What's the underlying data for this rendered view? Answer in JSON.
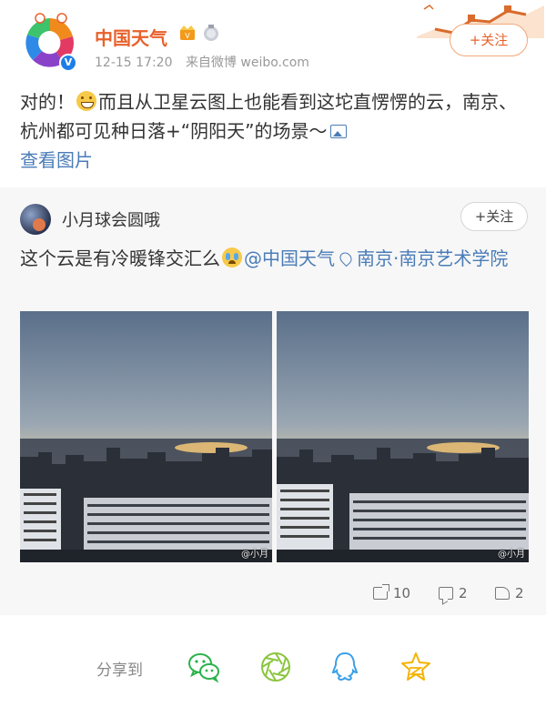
{
  "post": {
    "author": "中国天气",
    "time": "12-15 17:20",
    "source": "来自微博 weibo.com",
    "follow_label": "+关注",
    "text_part1": "对的！",
    "text_part2": "而且从卫星云图上也能看到这坨直愣愣的云，南京、杭州都可见种日落+“阴阳天”的场景～",
    "view_images_label": "查看图片"
  },
  "repost": {
    "author": "小月球会圆哦",
    "follow_label": "+关注",
    "text": "这个云是有冷暖锋交汇么",
    "mention": "@中国天气",
    "location": "南京·南京艺术学院",
    "watermark": "@小月",
    "stats": {
      "shares": "10",
      "comments": "2",
      "likes": "2"
    }
  },
  "share": {
    "label": "分享到",
    "targets": [
      "wechat-icon",
      "moments-icon",
      "qq-icon",
      "qzone-icon"
    ]
  },
  "colors": {
    "brand_orange": "#e8612c",
    "link_blue": "#4a7cb8",
    "wechat_green": "#2bb24c",
    "qq_blue": "#3aa0e8",
    "qzone_yellow": "#f5b400"
  }
}
